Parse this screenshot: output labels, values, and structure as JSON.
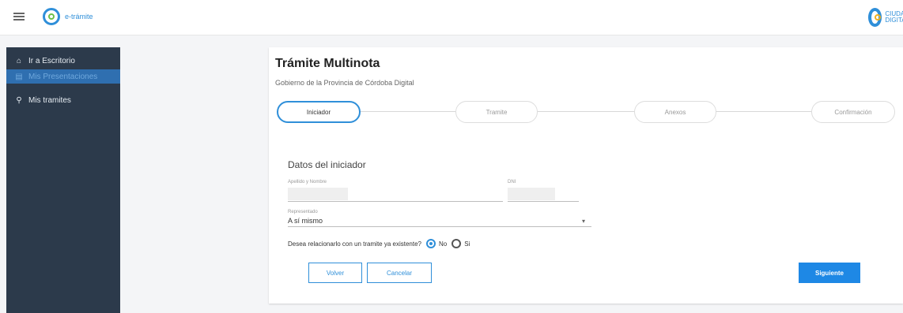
{
  "header": {
    "app_name": "e-trámite",
    "right_logo_text": "CIUDAD DIGITAL"
  },
  "sidebar": {
    "items": [
      {
        "label": "Ir a Escritorio",
        "icon": "home-icon",
        "active": false
      },
      {
        "label": "Mis Presentaciones",
        "icon": "document-icon",
        "active": true
      },
      {
        "label": "Mis tramites",
        "icon": "search-icon",
        "active": false
      }
    ]
  },
  "form": {
    "title": "Trámite Multinota",
    "subtitle": "Gobierno de la Provincia de Córdoba Digital",
    "steps": [
      "Iniciador",
      "Tramite",
      "Anexos",
      "Confirmación"
    ],
    "active_step": 0,
    "section_title": "Datos del iniciador",
    "fields": {
      "name_label": "Apellido y Nombre",
      "dni_label": "DNI",
      "represents_label": "Representado",
      "represents_value": "A sí mismo"
    },
    "question": "Desea relacionarlo con un tramite ya existente?",
    "options": [
      {
        "label": "No",
        "checked": true
      },
      {
        "label": "Si",
        "checked": false
      }
    ],
    "buttons": {
      "back": "Volver",
      "cancel": "Cancelar",
      "next": "Siguiente"
    }
  },
  "colors": {
    "accent": "#1e88e5",
    "sidebar_bg": "#2c3a4b",
    "sidebar_active": "#2f6fb0"
  }
}
